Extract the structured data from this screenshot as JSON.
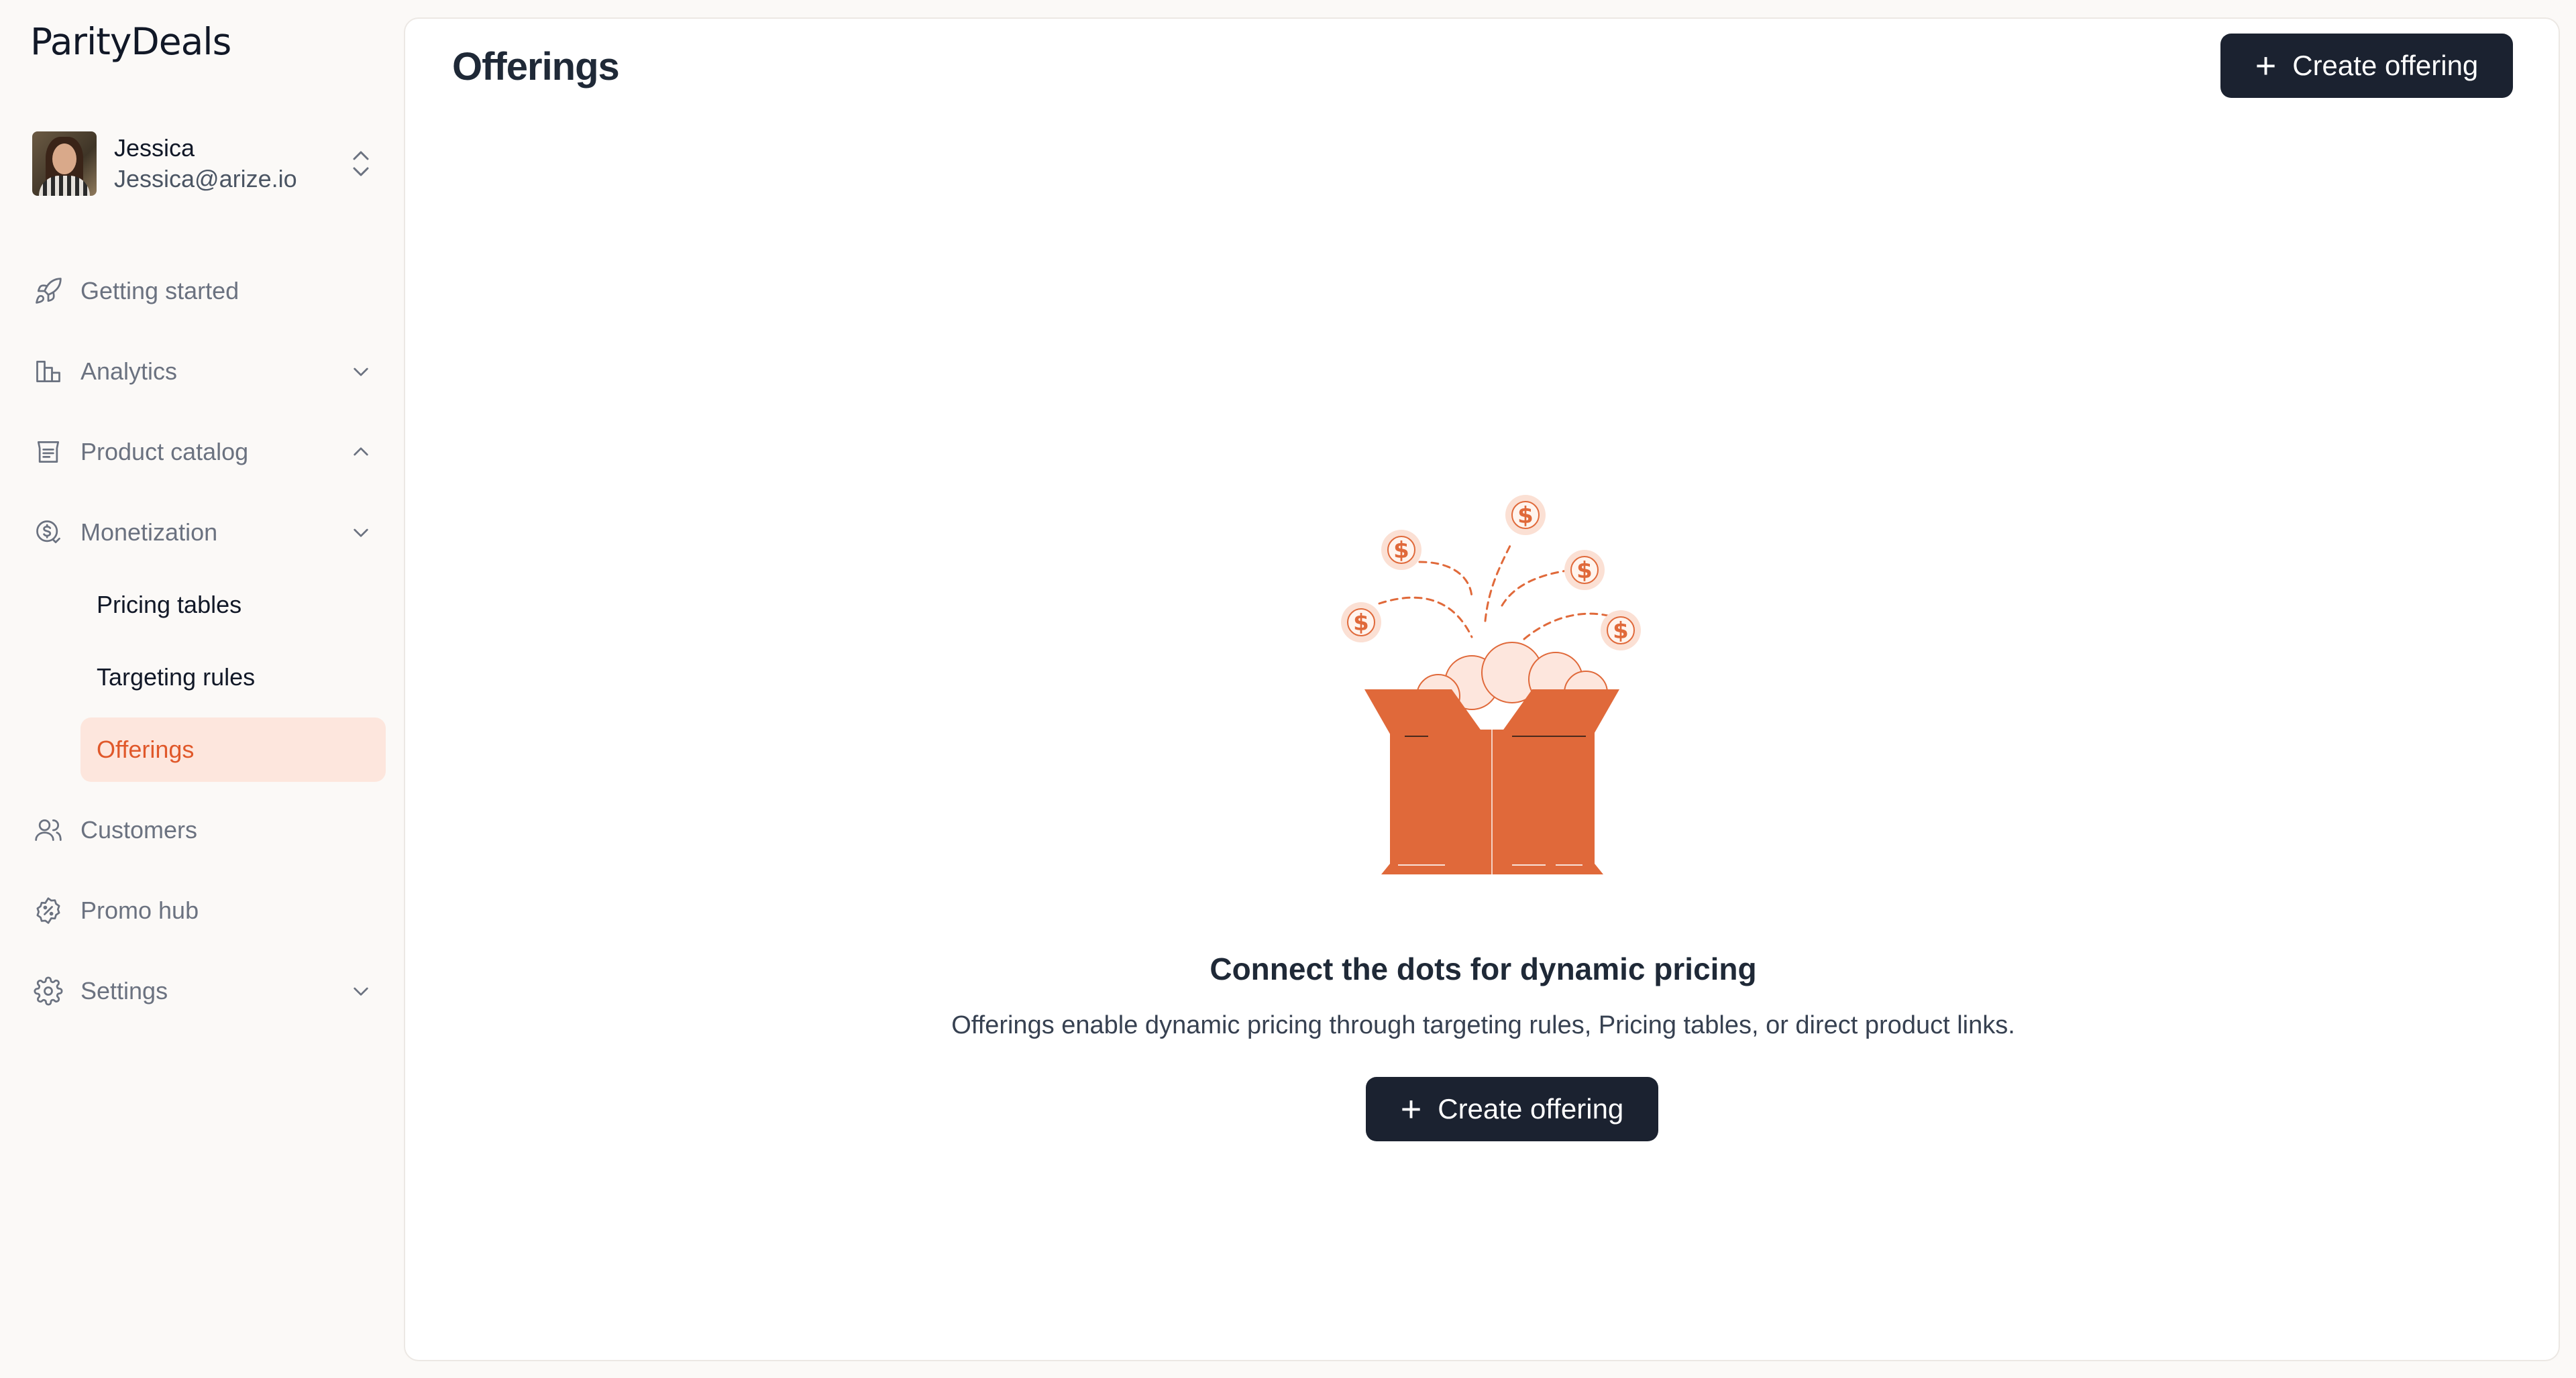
{
  "brand": {
    "logo_text": "ParityDeals"
  },
  "user": {
    "name": "Jessica",
    "email": "Jessica@arize.io"
  },
  "nav": {
    "getting_started": "Getting started",
    "analytics": "Analytics",
    "product_catalog": "Product catalog",
    "monetization": "Monetization",
    "monetization_items": {
      "pricing_tables": "Pricing tables",
      "targeting_rules": "Targeting rules",
      "offerings": "Offerings"
    },
    "customers": "Customers",
    "promo_hub": "Promo hub",
    "settings": "Settings"
  },
  "main": {
    "title": "Offerings",
    "create_button_label": "Create offering",
    "empty_title": "Connect the dots for dynamic pricing",
    "empty_description": "Offerings enable dynamic pricing through targeting rules, Pricing tables, or direct product links.",
    "empty_button_label": "Create offering"
  },
  "colors": {
    "accent": "#e0582a",
    "active_bg": "#fde6dd",
    "button_bg": "#1b2230",
    "box": "#e0693a"
  }
}
